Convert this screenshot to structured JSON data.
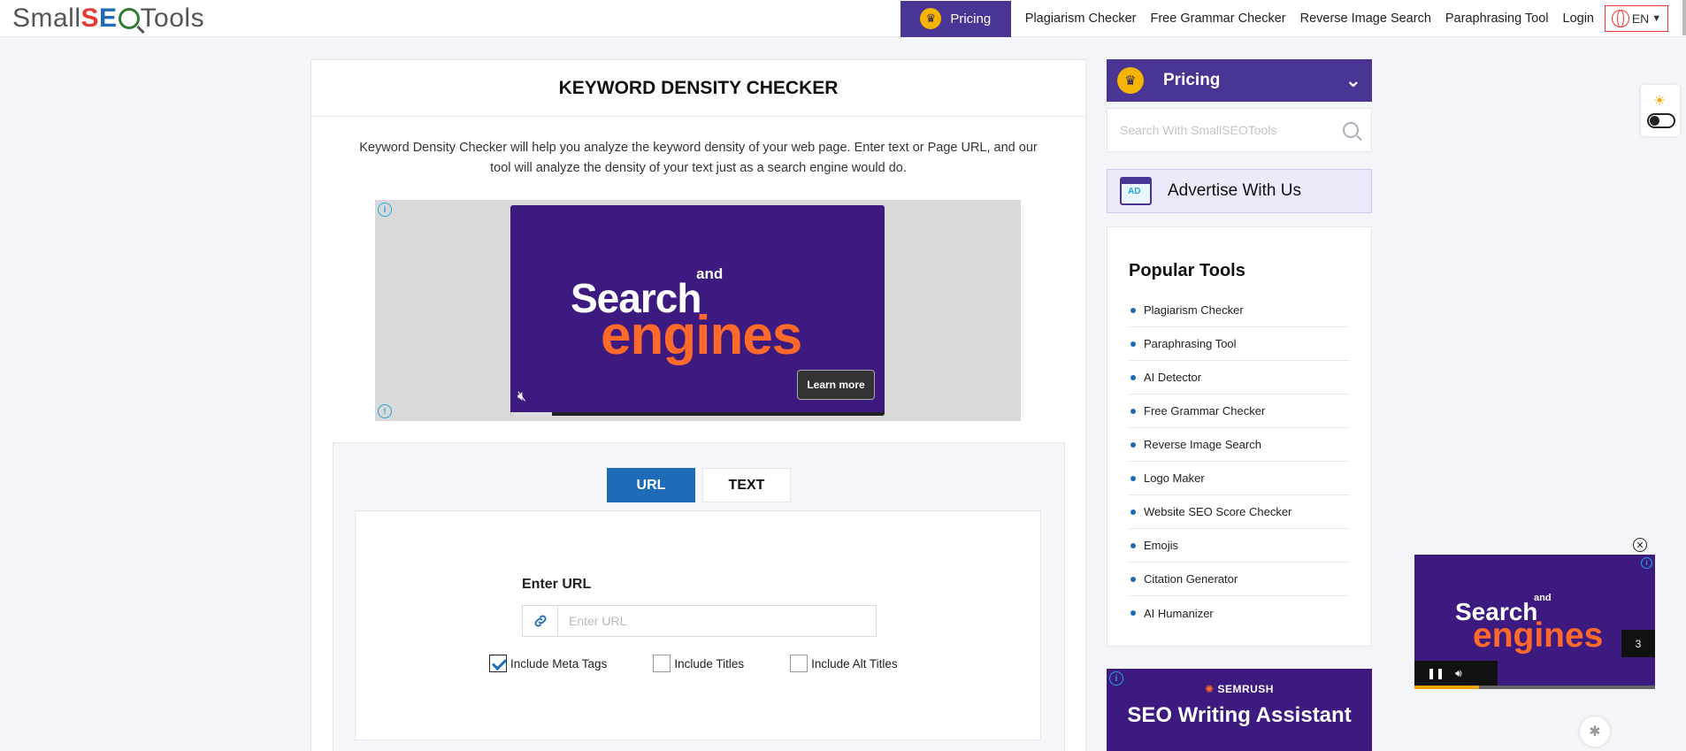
{
  "header": {
    "logo": {
      "part1": "Small",
      "s": "S",
      "e": "E",
      "part2": "Tools"
    },
    "pricing_label": "Pricing",
    "nav": [
      "Plagiarism Checker",
      "Free Grammar Checker",
      "Reverse Image Search",
      "Paraphrasing Tool",
      "Login"
    ],
    "language": "EN"
  },
  "main": {
    "title": "KEYWORD DENSITY CHECKER",
    "description": "Keyword Density Checker will help you analyze the keyword density of your web page. Enter text or Page URL, and our tool will analyze the density of your text just as a search engine would do.",
    "ad": {
      "word1": "Search",
      "word2": "and",
      "word3": "engines",
      "cta": "Learn more",
      "progress": 0.11
    },
    "tabs": [
      {
        "label": "URL",
        "active": true
      },
      {
        "label": "TEXT",
        "active": false
      }
    ],
    "url_label": "Enter URL",
    "url_placeholder": "Enter URL",
    "url_value": "",
    "checkboxes": [
      {
        "label": "Include Meta Tags",
        "checked": true
      },
      {
        "label": "Include Titles",
        "checked": false
      },
      {
        "label": "Include Alt Titles",
        "checked": false
      }
    ]
  },
  "sidebar": {
    "pricing_label": "Pricing",
    "search_placeholder": "Search With SmallSEOTools",
    "advertise_label": "Advertise With Us",
    "popular_title": "Popular Tools",
    "popular_tools": [
      "Plagiarism Checker",
      "Paraphrasing Tool",
      "AI Detector",
      "Free Grammar Checker",
      "Reverse Image Search",
      "Logo Maker",
      "Website SEO Score Checker",
      "Emojis",
      "Citation Generator",
      "AI Humanizer"
    ],
    "semrush": {
      "brand": "SEMRUSH",
      "headline": "SEO Writing Assistant"
    }
  },
  "mini_ad": {
    "word1": "Search",
    "word2": "and",
    "word3": "engines",
    "countdown": "3",
    "progress": 0.27
  },
  "colors": {
    "brand_purple": "#4a3594",
    "brand_blue": "#1e6bb8",
    "accent_orange": "#ff6a2a",
    "crown_gold": "#f5b400"
  }
}
